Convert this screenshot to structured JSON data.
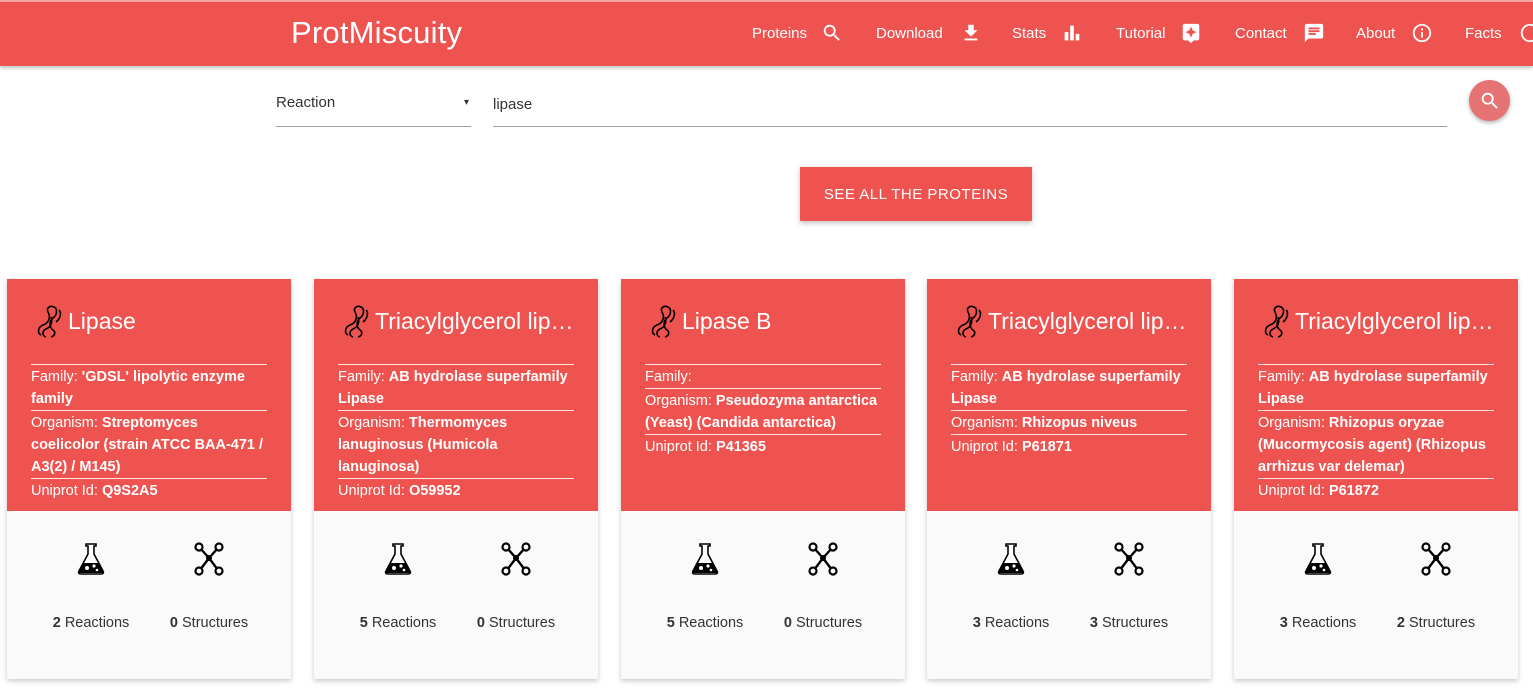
{
  "header": {
    "brand": "ProtMiscuity",
    "nav": [
      {
        "label": "Proteins",
        "icon": "search-icon"
      },
      {
        "label": "Download",
        "icon": "download-icon"
      },
      {
        "label": "Stats",
        "icon": "bar-chart-icon"
      },
      {
        "label": "Tutorial",
        "icon": "tutorial-icon"
      },
      {
        "label": "Contact",
        "icon": "message-icon"
      },
      {
        "label": "About",
        "icon": "info-icon"
      },
      {
        "label": "Facts",
        "icon": "facts-icon"
      }
    ]
  },
  "search": {
    "type_selected": "Reaction",
    "dropdown_arrow": "▾",
    "query": "lipase"
  },
  "see_all_label": "SEE ALL THE PROTEINS",
  "labels": {
    "family": "Family:",
    "organism": "Organism:",
    "uniprot": "Uniprot Id:",
    "reactions": "Reactions",
    "structures": "Structures"
  },
  "cards": [
    {
      "title": "Lipase",
      "family": "'GDSL' lipolytic enzyme family",
      "organism": "Streptomyces coelicolor (strain ATCC BAA-471 / A3(2) / M145)",
      "uniprot": "Q9S2A5",
      "reactions": "2",
      "structures": "0"
    },
    {
      "title": "Triacylglycerol lipase",
      "family": "AB hydrolase superfamily Lipase",
      "organism": "Thermomyces lanuginosus (Humicola lanuginosa)",
      "uniprot": "O59952",
      "reactions": "5",
      "structures": "0"
    },
    {
      "title": "Lipase B",
      "family": "",
      "organism": "Pseudozyma antarctica (Yeast) (Candida antarctica)",
      "uniprot": "P41365",
      "reactions": "5",
      "structures": "0"
    },
    {
      "title": "Triacylglycerol lipase",
      "family": "AB hydrolase superfamily Lipase",
      "organism": "Rhizopus niveus",
      "uniprot": "P61871",
      "reactions": "3",
      "structures": "3"
    },
    {
      "title": "Triacylglycerol lipase",
      "family": "AB hydrolase superfamily Lipase",
      "organism": "Rhizopus oryzae (Mucormycosis agent) (Rhizopus arrhizus var delemar)",
      "uniprot": "P61872",
      "reactions": "3",
      "structures": "2"
    }
  ],
  "colors": {
    "primary": "#ef5350",
    "fab": "#e57373",
    "card_bottom": "#fafafa"
  }
}
